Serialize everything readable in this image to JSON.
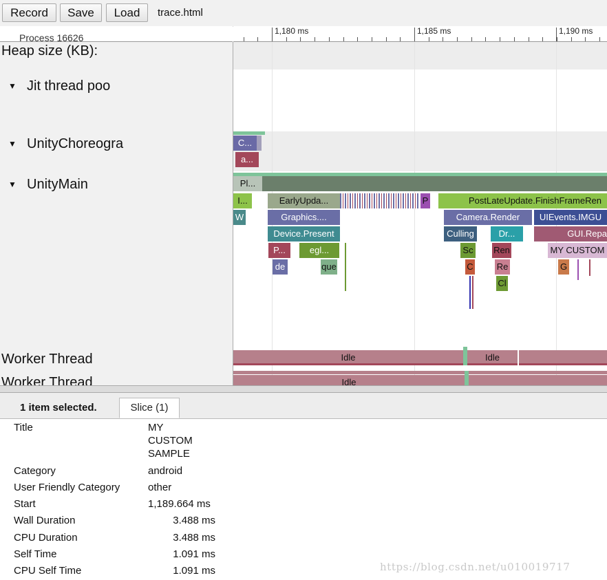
{
  "toolbar": {
    "record_label": "Record",
    "save_label": "Save",
    "load_label": "Load",
    "file_name": "trace.html"
  },
  "ruler": {
    "left_cut_text": "Process 16626",
    "ticks": [
      "1,180 ms",
      "1,185 ms",
      "1,190 ms"
    ]
  },
  "tracks": {
    "heap": "Heap size (KB):",
    "jit": "Jit thread poo",
    "choreographer": "UnityChoreogra",
    "main": "UnityMain",
    "worker1": "Worker Thread",
    "worker2": "Worker Thread"
  },
  "slices": {
    "choreo_c": "C...",
    "choreo_a": "a...",
    "pl": "Pl...",
    "i": "I...",
    "early_update": "EarlyUpda...",
    "p": "P",
    "post_late_update": "PostLateUpdate.FinishFrameRen",
    "w": "W",
    "graphics": "Graphics....",
    "camera_render": "Camera.Render",
    "uievents": "UIEvents.IMGU",
    "device_present": "Device.Present",
    "culling": "Culling",
    "dr": "Dr...",
    "gui_repaint": "GUI.Repa",
    "p2": "P...",
    "egl": "egl...",
    "sc": "Sc",
    "ren": "Ren",
    "my_custom": "MY CUSTOM",
    "de": "de",
    "que": "que",
    "c": "C",
    "re": "Re",
    "g": "G",
    "cl": "Cl",
    "idle": "Idle"
  },
  "panel": {
    "selected": "1 item selected.",
    "tab": "Slice (1)",
    "rows": [
      {
        "key": "Title",
        "value": "MY CUSTOM SAMPLE"
      },
      {
        "key": "Category",
        "value": "android"
      },
      {
        "key": "User Friendly Category",
        "value": "other"
      },
      {
        "key": "Start",
        "value": "1,189.664 ms"
      },
      {
        "key": "Wall Duration",
        "value": "3.488 ms"
      },
      {
        "key": "CPU Duration",
        "value": "3.488 ms"
      },
      {
        "key": "Self Time",
        "value": "1.091 ms"
      },
      {
        "key": "CPU Self Time",
        "value": "1.091 ms"
      }
    ],
    "title_lines": [
      "MY",
      "CUSTOM",
      "SAMPLE"
    ]
  },
  "watermark": "https://blog.csdn.net/u010019717",
  "colors": {
    "toolbar_bg": "#f1f1f1",
    "idle_slice": "#b6808b",
    "post_late_update": "#8dc34a",
    "camera_render": "#6a6ea6",
    "my_custom_sample": "#d8b8d4"
  }
}
